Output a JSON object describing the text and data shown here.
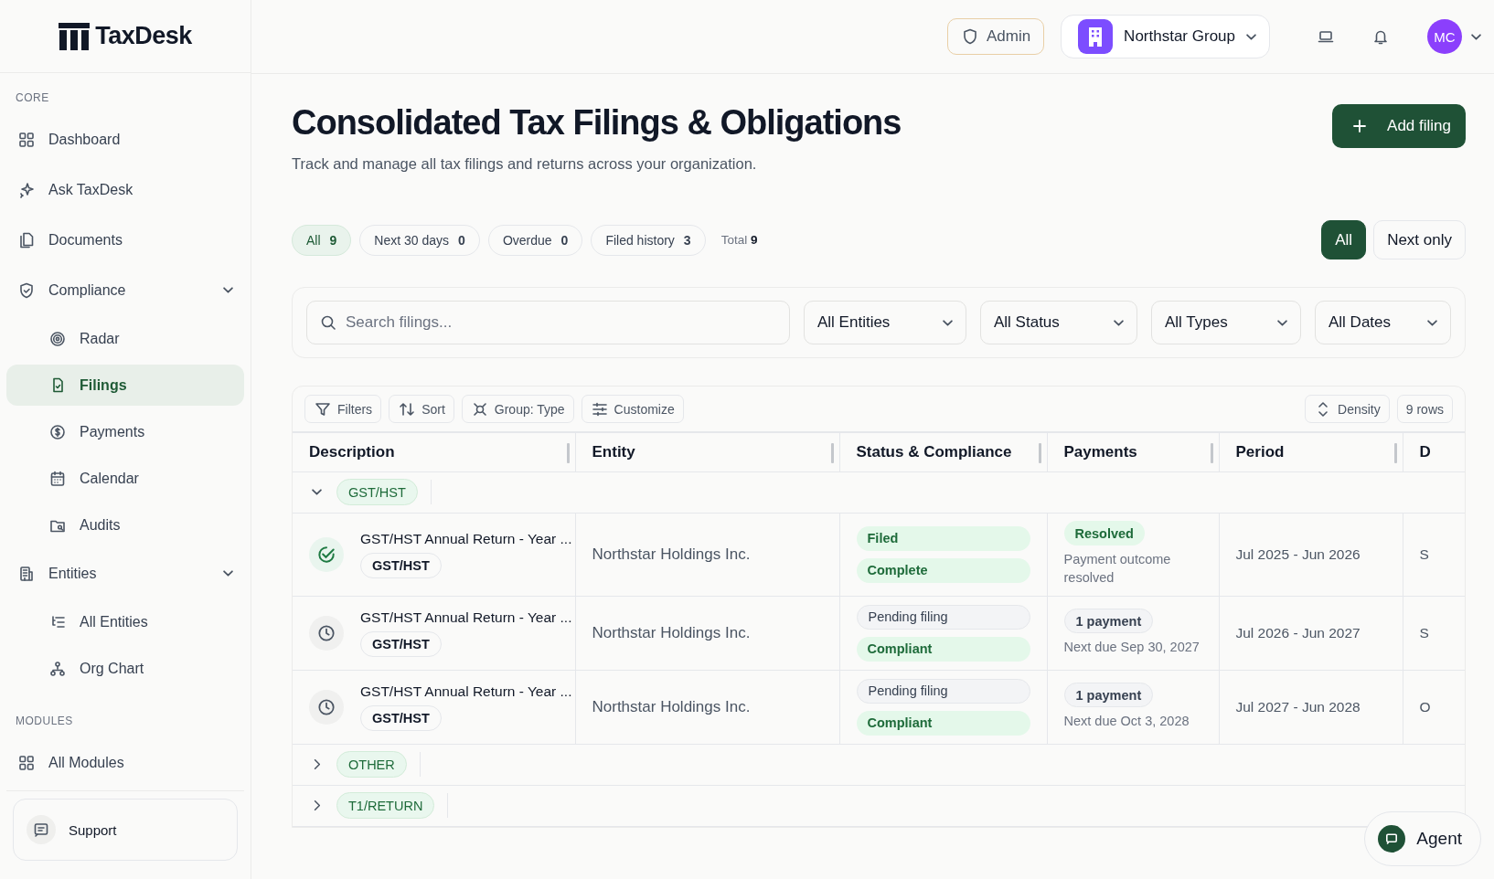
{
  "app": {
    "name": "TaxDesk"
  },
  "sidebar": {
    "sections": [
      {
        "label": "CORE",
        "items": [
          {
            "label": "Dashboard",
            "selected": false
          },
          {
            "label": "Ask TaxDesk",
            "selected": false
          },
          {
            "label": "Documents",
            "selected": false
          },
          {
            "label": "Compliance",
            "selected": false,
            "expanded": true,
            "children": [
              {
                "label": "Radar",
                "selected": false
              },
              {
                "label": "Filings",
                "selected": true
              },
              {
                "label": "Payments",
                "selected": false
              },
              {
                "label": "Calendar",
                "selected": false
              },
              {
                "label": "Audits",
                "selected": false
              }
            ]
          },
          {
            "label": "Entities",
            "selected": false,
            "expanded": true,
            "children": [
              {
                "label": "All Entities",
                "selected": false
              },
              {
                "label": "Org Chart",
                "selected": false
              }
            ]
          }
        ]
      },
      {
        "label": "MODULES",
        "items": [
          {
            "label": "All Modules",
            "selected": false
          }
        ]
      }
    ],
    "support": "Support"
  },
  "header": {
    "role": "Admin",
    "organization": "Northstar Group",
    "avatar": "MC"
  },
  "page": {
    "title": "Consolidated Tax Filings & Obligations",
    "subtitle": "Track and manage all tax filings and returns across your organization.",
    "primary_action": "Add filing"
  },
  "chips": [
    {
      "label": "All",
      "count": "9",
      "selected": true
    },
    {
      "label": "Next 30 days",
      "count": "0",
      "selected": false
    },
    {
      "label": "Overdue",
      "count": "0",
      "selected": false
    },
    {
      "label": "Filed history",
      "count": "3",
      "selected": false
    }
  ],
  "total": {
    "label": "Total",
    "value": "9"
  },
  "view_toggle": [
    {
      "label": "All",
      "selected": true
    },
    {
      "label": "Next only",
      "selected": false
    }
  ],
  "filters": {
    "search_placeholder": "Search filings...",
    "dropdowns": [
      "All Entities",
      "All Status",
      "All Types",
      "All Dates"
    ]
  },
  "toolbar": {
    "left": [
      "Filters",
      "Sort",
      "Group: Type",
      "Customize"
    ],
    "density": "Density",
    "rows": "9 rows"
  },
  "table": {
    "columns": [
      "Description",
      "Entity",
      "Status & Compliance",
      "Payments",
      "Period",
      "D"
    ],
    "groups": [
      {
        "label": "GST/HST",
        "expanded": true,
        "rows": [
          {
            "kind": "done",
            "description": "GST/HST Annual Return - Year ...",
            "tag": "GST/HST",
            "entity": "Northstar Holdings Inc.",
            "filing": {
              "text": "Filed",
              "kind": "filed"
            },
            "compliance": "Complete",
            "payment": {
              "text": "Resolved",
              "kind": "resolved"
            },
            "payment_note": "Payment outcome resolved",
            "period": "Jul 2025 - Jun 2026",
            "column_6": "S"
          },
          {
            "kind": "pending",
            "description": "GST/HST Annual Return - Year ...",
            "tag": "GST/HST",
            "entity": "Northstar Holdings Inc.",
            "filing": {
              "text": "Pending filing",
              "kind": "pending"
            },
            "compliance": "Compliant",
            "payment": {
              "text": "1 payment",
              "kind": "count"
            },
            "payment_note": "Next due Sep 30, 2027",
            "period": "Jul 2026 - Jun 2027",
            "column_6": "S"
          },
          {
            "kind": "pending",
            "description": "GST/HST Annual Return - Year ...",
            "tag": "GST/HST",
            "entity": "Northstar Holdings Inc.",
            "filing": {
              "text": "Pending filing",
              "kind": "pending"
            },
            "compliance": "Compliant",
            "payment": {
              "text": "1 payment",
              "kind": "count"
            },
            "payment_note": "Next due Oct 3, 2028",
            "period": "Jul 2027 - Jun 2028",
            "column_6": "O"
          }
        ]
      },
      {
        "label": "OTHER",
        "expanded": false
      },
      {
        "label": "T1/RETURN",
        "expanded": false
      }
    ]
  },
  "agent_button": "Agent"
}
